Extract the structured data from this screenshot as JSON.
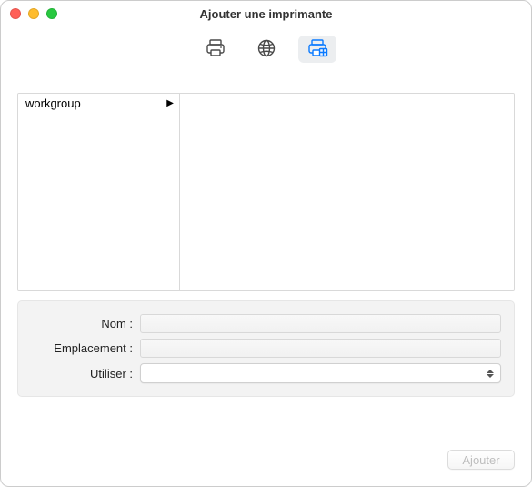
{
  "window": {
    "title": "Ajouter une imprimante"
  },
  "toolbar": {
    "default_icon": "printer-icon",
    "ip_icon": "globe-icon",
    "windows_icon": "printer-windows-icon",
    "active_index": 2
  },
  "browser": {
    "left_items": [
      {
        "label": "workgroup"
      }
    ]
  },
  "form": {
    "name_label": "Nom :",
    "name_value": "",
    "location_label": "Emplacement :",
    "location_value": "",
    "use_label": "Utiliser :",
    "use_value": ""
  },
  "footer": {
    "add_label": "Ajouter"
  }
}
